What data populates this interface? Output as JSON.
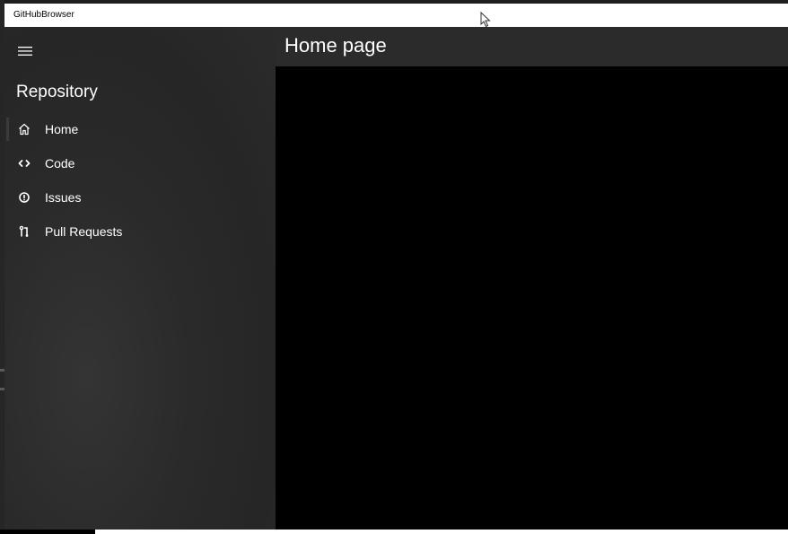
{
  "window": {
    "title": "GitHubBrowser"
  },
  "nav": {
    "menu_icon": "hamburger-icon",
    "header": "Repository",
    "items": [
      {
        "label": "Home",
        "icon": "home-icon",
        "selected": true
      },
      {
        "label": "Code",
        "icon": "code-icon",
        "selected": false
      },
      {
        "label": "Issues",
        "icon": "issue-icon",
        "selected": false
      },
      {
        "label": "Pull Requests",
        "icon": "pull-request-icon",
        "selected": false
      }
    ]
  },
  "content": {
    "title": "Home page"
  },
  "colors": {
    "titlebar": "#ffffff",
    "nav_background": "#2b2b2b",
    "content_header": "#2b2b2b",
    "content_background": "#000000",
    "text": "#ffffff"
  }
}
